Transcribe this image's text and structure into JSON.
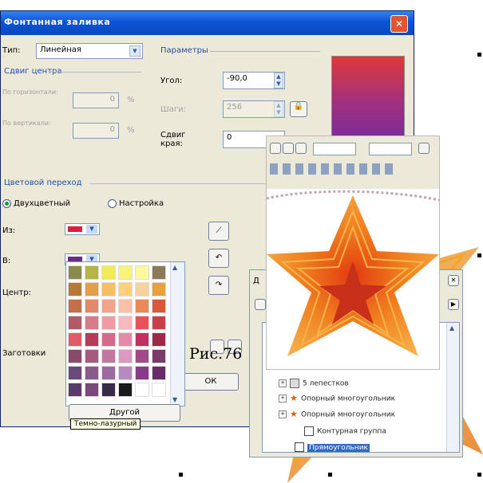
{
  "dialog": {
    "title": "Фонтанная заливка",
    "type_label": "Тип:",
    "type_value": "Линейная",
    "center_offset_label": "Сдвиг центра",
    "horizontal_label": "По горизонтали:",
    "horizontal_value": "0",
    "vertical_label": "По вертикали:",
    "vertical_value": "0",
    "percent": "%",
    "params_label": "Параметры",
    "angle_label": "Угол:",
    "angle_value": "-90,0",
    "steps_label": "Шаги:",
    "steps_value": "256",
    "edge_pad_label": "Сдвиг края:",
    "edge_pad_value": "0",
    "blend_label": "Цветовой переход",
    "two_color_label": "Двухцветный",
    "custom_label": "Настройка",
    "from_label": "Из:",
    "to_label": "В:",
    "mid_label": "Центр:",
    "presets_label": "Заготовки",
    "ok_label": "ОК",
    "other_label": "Другой",
    "tooltip": "Темно-лазурный",
    "colors": {
      "from": "#d81f3c",
      "to": "#6a2a8a"
    }
  },
  "palette": {
    "colors": [
      [
        "#8a8a4a",
        "#b5b545",
        "#f2ea57",
        "#f9f377",
        "#fff8a0",
        "#8a7a5a"
      ],
      [
        "#b57a3a",
        "#e3a04a",
        "#f6c060",
        "#ffd27a",
        "#f5d2a0",
        "#e8a23d"
      ],
      [
        "#c2704a",
        "#e08a6a",
        "#f0a58a",
        "#f7c2a8",
        "#e88a5a",
        "#d65a3a"
      ],
      [
        "#b35a6a",
        "#d87a8a",
        "#f09aa2",
        "#f7b9bd",
        "#e8505a",
        "#c8404a"
      ],
      [
        "#e05a6a",
        "#b53a5a",
        "#d56a8a",
        "#e78aa8",
        "#c03060",
        "#9e2a4a"
      ],
      [
        "#8a4a6a",
        "#a55a80",
        "#c07aa0",
        "#d89ac0",
        "#a04a8a",
        "#7a3a6a"
      ],
      [
        "#6a4a7a",
        "#8a5a8a",
        "#9a6aa0",
        "#b58ac0",
        "#8a3a8a",
        "#6a2a6a"
      ],
      [
        "#5a3a6a",
        "#7a4a7a",
        "#3a2a4a",
        "#1a1a1a",
        "#ffffff",
        "#ffffff"
      ]
    ]
  },
  "object_manager": {
    "header_letter": "Д",
    "rows": [
      {
        "label": "5 лепестков",
        "icon": "group-icon"
      },
      {
        "label": "Опорный многоугольник",
        "icon": "star-icon"
      },
      {
        "label": "Опорный многоугольник",
        "icon": "star-icon"
      },
      {
        "label": "Контурная группа",
        "icon": "contour-icon"
      },
      {
        "label": "Прямоугольник",
        "icon": "rectangle-icon"
      }
    ]
  },
  "figure": {
    "caption": "Рис.76"
  }
}
